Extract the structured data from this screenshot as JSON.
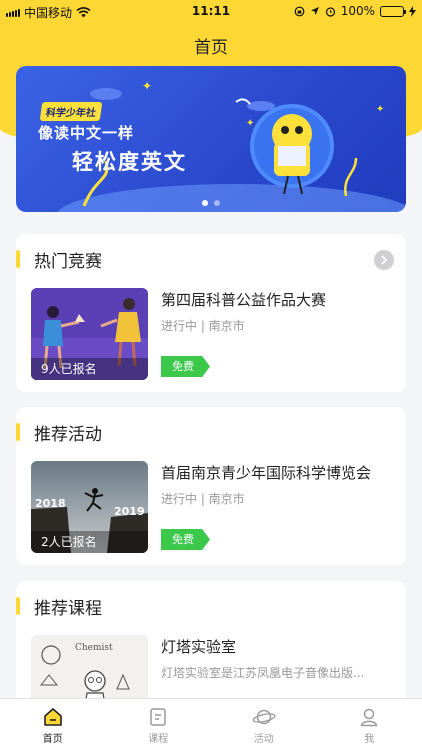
{
  "status_bar": {
    "carrier": "中国移动",
    "time": "11:11",
    "battery": "100%"
  },
  "header": {
    "title": "首页"
  },
  "banner": {
    "tag": "科学少年社",
    "line1": "像读中文一样",
    "line2": "轻松度英文",
    "page_count": 2,
    "active_page": 1
  },
  "sections": {
    "competition": {
      "title": "热门竞赛",
      "item": {
        "name": "第四届科普公益作品大赛",
        "meta": "进行中 | 南京市",
        "count": "9人已报名",
        "badge": "免费"
      }
    },
    "activity": {
      "title": "推荐活动",
      "item": {
        "name": "首届南京青少年国际科学博览会",
        "meta": "进行中 | 南京市",
        "count": "2人已报名",
        "badge": "免费"
      }
    },
    "course": {
      "title": "推荐课程",
      "item": {
        "name": "灯塔实验室",
        "desc": "灯塔实验室是江苏凤凰电子音像出版..."
      }
    }
  },
  "thumb_labels": {
    "year_left": "2018",
    "year_right": "2019",
    "chemist": "Chemist"
  },
  "tabbar": [
    {
      "label": "首页",
      "icon": "home-icon",
      "active": true
    },
    {
      "label": "课程",
      "icon": "course-icon",
      "active": false
    },
    {
      "label": "活动",
      "icon": "planet-icon",
      "active": false
    },
    {
      "label": "我",
      "icon": "user-icon",
      "active": false
    }
  ],
  "colors": {
    "accent": "#fdd835",
    "badge": "#3bc84b",
    "banner": "#2a48cc"
  }
}
